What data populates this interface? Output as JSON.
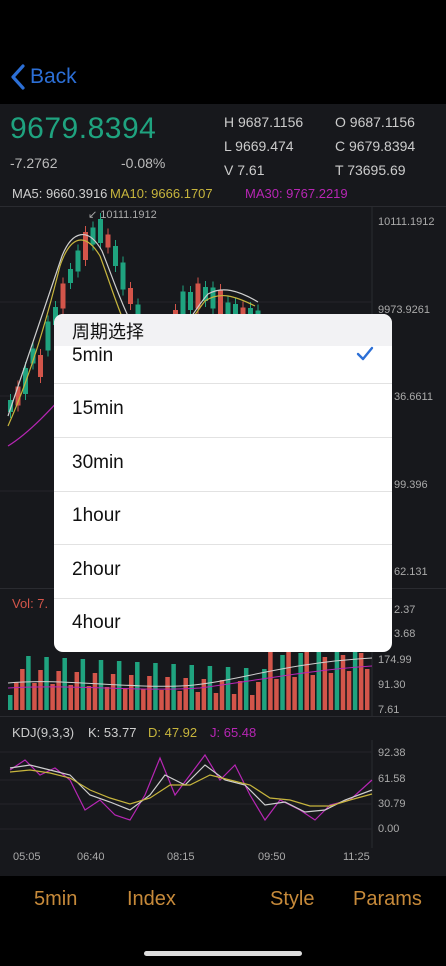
{
  "nav": {
    "back_label": "Back"
  },
  "ticker": {
    "price": "9679.8394",
    "change": "-7.2762",
    "change_pct": "-0.08%",
    "high": "H 9687.1156",
    "open": "O 9687.1156",
    "low": "L 9669.474",
    "close": "C 9679.8394",
    "volume": "V 7.61",
    "turnover": "T 73695.69"
  },
  "ma": {
    "ma5": "MA5: 9660.3916",
    "ma10": "MA10: 9666.1707",
    "ma30": "MA30: 9767.2219",
    "ma5_color": "#cfcfcf",
    "ma10_color": "#c7b53d",
    "ma30_color": "#b726b4"
  },
  "price_axis": {
    "max_marker": "10111.1912",
    "ticks": [
      "10111.1912",
      "9973.9261",
      "36.6611",
      "99.396",
      "62.131"
    ]
  },
  "volume": {
    "label": "Vol: 7.",
    "ticks": [
      "2.37",
      "3.68",
      "174.99",
      "91.30",
      "7.61"
    ]
  },
  "kdj": {
    "label": "KDJ(9,3,3)",
    "k": "K: 53.77",
    "d": "D: 47.92",
    "j": "J: 65.48",
    "ticks": [
      "92.38",
      "61.58",
      "30.79",
      "0.00"
    ]
  },
  "time_axis": [
    "05:05",
    "06:40",
    "08:15",
    "09:50",
    "11:25"
  ],
  "bottom_bar": {
    "period": "5min",
    "index": "Index",
    "style": "Style",
    "params": "Params"
  },
  "dialog": {
    "title": "周期选择",
    "options": [
      "5min",
      "15min",
      "30min",
      "1hour",
      "2hour",
      "4hour"
    ],
    "selected": "5min"
  },
  "colors": {
    "up": "#1fa37f",
    "down": "#d3554a",
    "accent": "#2c6fd6",
    "bottom_text": "#c78a3a"
  }
}
